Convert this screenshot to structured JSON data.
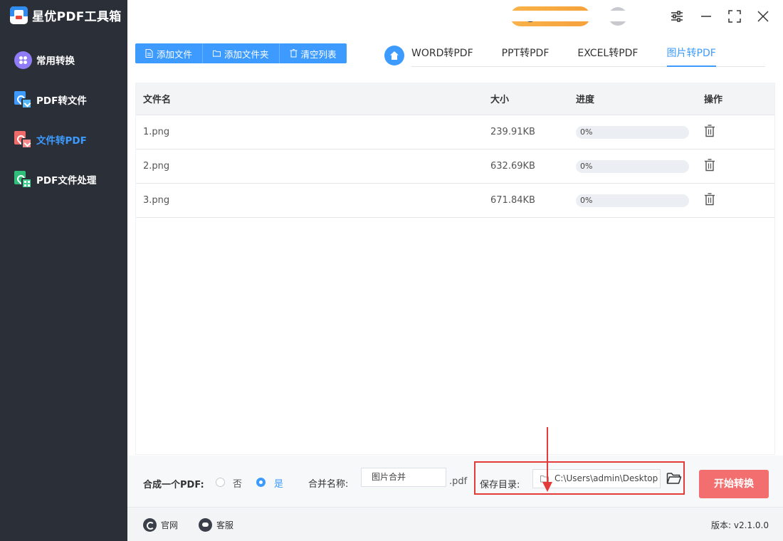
{
  "app": {
    "title": "星优PDF工具箱"
  },
  "sidebar": {
    "items": [
      {
        "label": "常用转换",
        "icon": "grid-circle-icon",
        "active": false
      },
      {
        "label": "PDF转文件",
        "icon": "pdf-to-file-icon",
        "active": false
      },
      {
        "label": "文件转PDF",
        "icon": "file-to-pdf-icon",
        "active": true
      },
      {
        "label": "PDF文件处理",
        "icon": "pdf-process-icon",
        "active": false
      }
    ]
  },
  "window_controls": [
    "settings-sliders-icon",
    "minimize-icon",
    "maximize-icon",
    "close-icon"
  ],
  "toolbar": {
    "add_file": "添加文件",
    "add_folder": "添加文件夹",
    "clear_list": "清空列表"
  },
  "tabs": [
    {
      "label": "WORD转PDF",
      "active": false
    },
    {
      "label": "PPT转PDF",
      "active": false
    },
    {
      "label": "EXCEL转PDF",
      "active": false
    },
    {
      "label": "图片转PDF",
      "active": true
    }
  ],
  "table": {
    "headers": {
      "name": "文件名",
      "size": "大小",
      "progress": "进度",
      "action": "操作"
    },
    "rows": [
      {
        "name": "1.png",
        "size": "239.91KB",
        "progress": "0%",
        "progress_value": 0
      },
      {
        "name": "2.png",
        "size": "632.69KB",
        "progress": "0%",
        "progress_value": 0
      },
      {
        "name": "3.png",
        "size": "671.84KB",
        "progress": "0%",
        "progress_value": 0
      }
    ]
  },
  "options": {
    "merge_label": "合成一个PDF:",
    "no_label": "否",
    "yes_label": "是",
    "merge_selected": "是",
    "merge_name_label": "合并名称:",
    "merge_name_value": "图片合并",
    "pdf_suffix": ".pdf",
    "save_dir_label": "保存目录:",
    "save_dir_value": "C:\\Users\\admin\\Desktop",
    "start_button": "开始转换"
  },
  "footer": {
    "website": "官网",
    "support": "客服",
    "version": "版本: v2.1.0.0"
  },
  "colors": {
    "accent": "#3d9bff",
    "sidebar_bg": "#2b2f38",
    "start_button": "#f36f6f",
    "highlight_red": "#e43a3a"
  }
}
